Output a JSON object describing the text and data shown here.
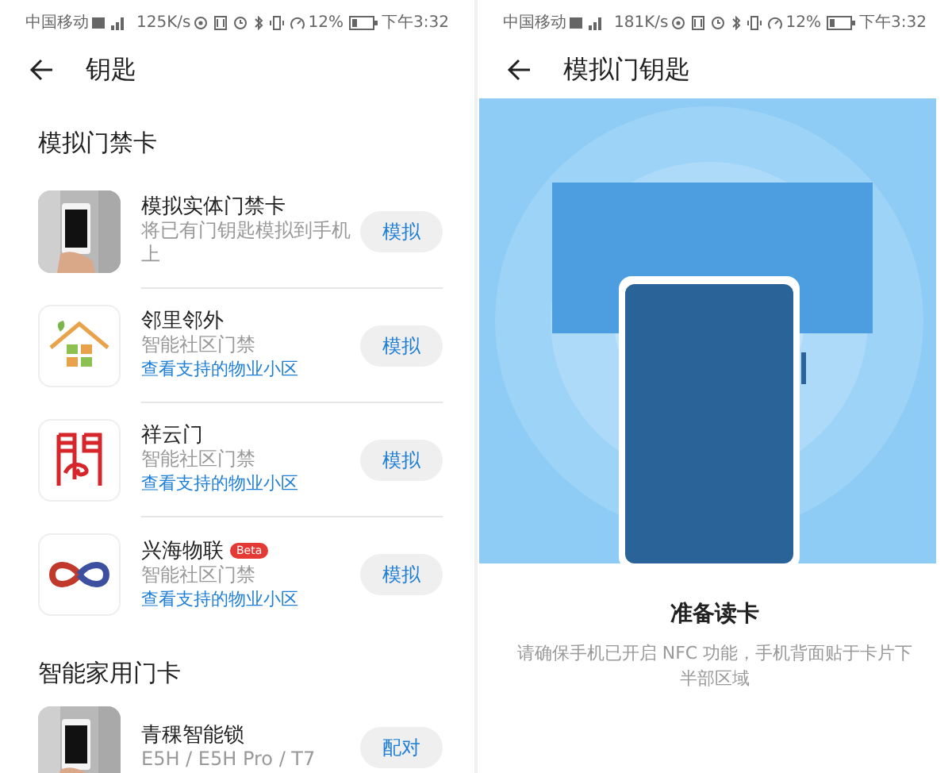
{
  "left_screen": {
    "status_bar": {
      "carrier": "中国移动",
      "speed": "125K/s",
      "battery": "12%",
      "time": "下午3:32"
    },
    "title": "钥匙",
    "sections": [
      {
        "title": "模拟门禁卡",
        "items": [
          {
            "kind": "picture",
            "name": "模拟实体门禁卡",
            "subtitle": "将已有门钥匙模拟到手机上",
            "button": "模拟"
          },
          {
            "kind": "house",
            "name": "邻里邻外",
            "subtitle": "智能社区门禁",
            "link": "查看支持的物业小区",
            "button": "模拟"
          },
          {
            "kind": "gate",
            "name": "祥云门",
            "subtitle": "智能社区门禁",
            "link": "查看支持的物业小区",
            "button": "模拟"
          },
          {
            "kind": "infinity",
            "name": "兴海物联",
            "badge": "Beta",
            "subtitle": "智能社区门禁",
            "link": "查看支持的物业小区",
            "button": "模拟"
          }
        ]
      },
      {
        "title": "智能家用门卡",
        "items": [
          {
            "kind": "picture",
            "name": "青稞智能锁",
            "subtitle": "E5H / E5H Pro / T7",
            "button": "配对"
          }
        ]
      }
    ]
  },
  "right_screen": {
    "status_bar": {
      "carrier": "中国移动",
      "speed": "181K/s",
      "battery": "12%",
      "time": "下午3:32"
    },
    "title": "模拟门钥匙",
    "prompt_title": "准备读卡",
    "prompt_text": "请确保手机已开启 NFC 功能，手机背面贴于卡片下半部区域"
  }
}
